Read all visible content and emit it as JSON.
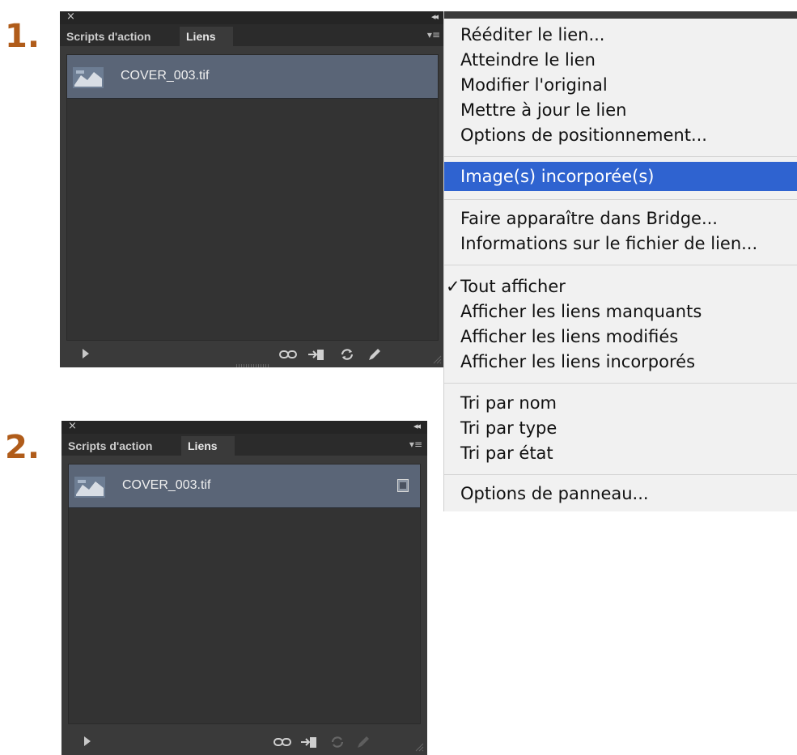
{
  "step1_label": "1.",
  "step2_label": "2.",
  "panel": {
    "tab_scripts": "Scripts d'action",
    "tab_links": "Liens",
    "file_name": "COVER_003.tif"
  },
  "context_menu": {
    "items": [
      "Rééditer le lien...",
      "Atteindre le lien",
      "Modifier l'original",
      "Mettre à jour le lien",
      "Options de positionnement...",
      "Image(s) incorporée(s)",
      "Faire apparaître dans Bridge...",
      "Informations sur le fichier de lien...",
      "Tout afficher",
      "Afficher les liens manquants",
      "Afficher les liens modifiés",
      "Afficher les liens incorporés",
      "Tri par nom",
      "Tri par type",
      "Tri par état",
      "Options de panneau..."
    ],
    "highlighted": "Image(s) incorporée(s)",
    "checked": "Tout afficher",
    "check_glyph": "✓"
  },
  "colors": {
    "step_number": "#b05c1a",
    "panel_bg": "#3a3a3a",
    "selected_row": "#5a6577",
    "menu_highlight": "#2f63d0"
  },
  "icons": [
    "close-icon",
    "collapse-icon",
    "panel-menu-icon",
    "thumbnail-icon",
    "embedded-icon",
    "play-icon",
    "relink-icon",
    "goto-link-icon",
    "update-link-icon",
    "edit-original-icon",
    "resize-grip-icon",
    "check-icon"
  ]
}
